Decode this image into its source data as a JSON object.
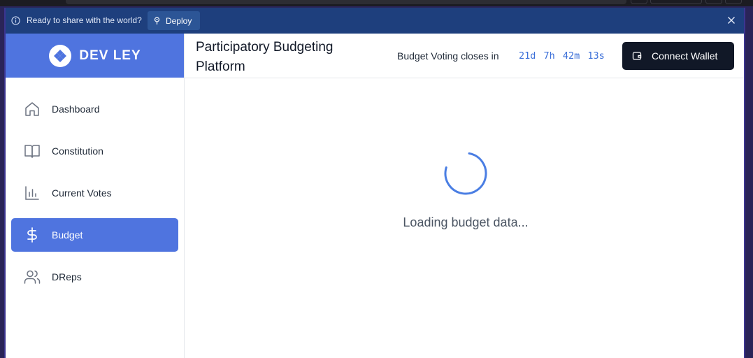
{
  "banner": {
    "message": "Ready to share with the world?",
    "deploy_label": "Deploy"
  },
  "brand": {
    "logo_text": "DEV LEY",
    "accent_color": "#4f74df"
  },
  "sidebar": {
    "items": [
      {
        "label": "Dashboard",
        "icon": "home-icon",
        "active": false
      },
      {
        "label": "Constitution",
        "icon": "book-icon",
        "active": false
      },
      {
        "label": "Current Votes",
        "icon": "bar-chart-icon",
        "active": false
      },
      {
        "label": "Budget",
        "icon": "dollar-icon",
        "active": true
      },
      {
        "label": "DReps",
        "icon": "users-icon",
        "active": false
      }
    ]
  },
  "header": {
    "title": "Participatory Budgeting Platform",
    "timer_label": "Budget Voting closes in",
    "timer_value": "21d 7h 42m 13s",
    "wallet_label": "Connect Wallet"
  },
  "main": {
    "loading_text": "Loading budget data..."
  }
}
